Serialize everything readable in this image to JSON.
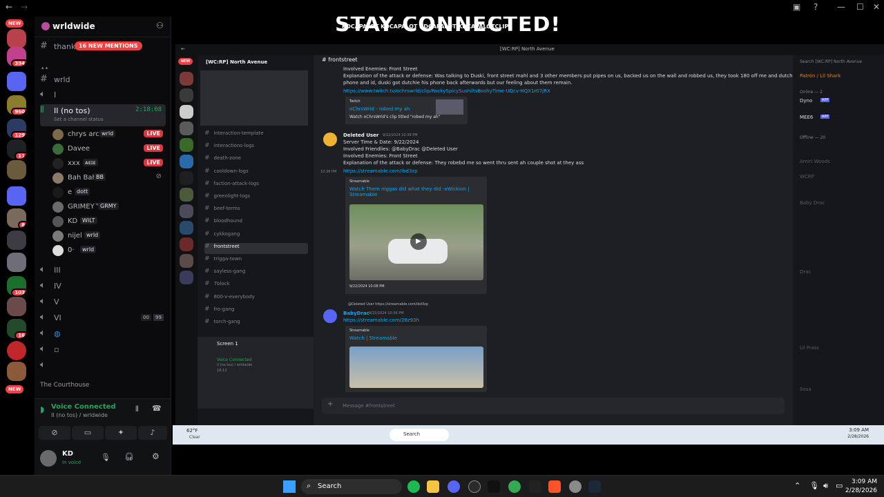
{
  "outer_window": {
    "controls": [
      "—",
      "☐",
      "✕"
    ]
  },
  "rail": {
    "new_top": "NEW",
    "badges": [
      "394",
      "960",
      "129",
      "11",
      "8",
      "103",
      "16"
    ],
    "new_bottom": "NEW"
  },
  "sidebar": {
    "server_name": "wrldwide",
    "mentions_channel": "thanks",
    "mentions_badge": "16 NEW MENTIONS",
    "text_channel": "wrld",
    "voice_channels_top": [
      "I"
    ],
    "active_voice": {
      "name": "II (no tos)",
      "timer": "2:18:08",
      "status": "Set a channel status"
    },
    "users": [
      {
        "name": "chrys arc",
        "tag": "wrld",
        "live": "LIVE"
      },
      {
        "name": "Davee",
        "tag": "",
        "live": "LIVE"
      },
      {
        "name": "xxx",
        "tag": "ᴀᴇɪᴇ",
        "live": "LIVE"
      },
      {
        "name": "Bah Bah",
        "tag": "BB",
        "live": ""
      },
      {
        "name": "e",
        "tag": "dott",
        "live": ""
      },
      {
        "name": "GRIMEY™",
        "tag": "GRMY",
        "live": ""
      },
      {
        "name": "KD",
        "tag": "WILT",
        "live": ""
      },
      {
        "name": "nijel",
        "tag": "wrld",
        "live": ""
      },
      {
        "name": "0·",
        "tag": "wrld",
        "live": ""
      }
    ],
    "voice_channels_bottom": [
      "III",
      "IV",
      "V",
      "VI"
    ],
    "vi_counts": [
      "00",
      "99"
    ],
    "category": "The Courthouse",
    "voice_panel": {
      "status": "Voice Connected",
      "sub": "II (no tos) / wrldwide"
    },
    "user_panel": {
      "name": "KD",
      "status": "In voice"
    }
  },
  "stream": {
    "banner_title": "STAY CONNECTED!",
    "banner_socials": "KDCAPALOT  KDCAPALOT  KDCAPALOT  KDCAPALOTCLIPS",
    "inner": {
      "window_title": "[WC:RP] North Avenue",
      "server_name": "[WC:RP] North Avenue",
      "new_pill": "NEW",
      "channels": [
        "interaction-template",
        "interactions-logs",
        "death-zone",
        "cooldown-logs",
        "faction-attack-logs",
        "greenlight-logs",
        "beef-terms",
        "bloodhound",
        "cykkogang",
        "frontstreet",
        "trigga-town",
        "sayless-gang",
        "7block",
        "800-v-everybody",
        "fro-gang",
        "torch-gang"
      ],
      "active_channel": "frontstreet",
      "screen_label": "Screen 1",
      "voice_connected": "Voice Connected",
      "voice_sub": "II (no tos) / wrldwide",
      "voice_time": "18:13",
      "chat_channel": "frontstreet",
      "messages": {
        "m1_enemies": "Involved Enemies: Front Street",
        "m1_expl": "Explanation of the attack or defense: Was talking to Duski, front street mahl and 3 other members put pipes on us, backed us on the wall and robbed us, they took 180 off me and dutchies",
        "m1_expl2": "phone and id, duski got dutchie his phone back afterwards but our feeling about them remain.",
        "m1_link": "https://www.twitch.tv/ochrswrld/clip/RockySpicySushiltsBoshyTime-UQcv-HQX1r07jRX",
        "m1_embed_site": "Twitch",
        "m1_embed_title": "oChrsWrld - robed my ah",
        "m1_embed_desc": "Watch oChrsWrld's clip titled \"robed my ah\"",
        "m2_author": "Deleted User",
        "m2_time": "9/22/2024 10:36 PM",
        "m2_server_time": "Server Time & Date: 9/22/2024",
        "m2_friendlies": "Involved Friendlies: @BabyDrac @Deleted User",
        "m2_enemies": "Involved Enemies: Front Street",
        "m2_expl": "Explanation of the attack or defense: They robebd me so went thru sent ah couple shot at they ass",
        "m2_link": "https://streamable.com/ibd3zp",
        "m2_side_time": "10:36 PM",
        "m2_embed_site": "Streamable",
        "m2_embed_title": "Watch Them niggas did what they did -xWickion | Streamable",
        "m2_video_time": "9/22/2024 10:08 PM",
        "m3_reply": "@Deleted User https://streamable.com/ibd3zp",
        "m3_author": "BabyDrac",
        "m3_time": "9/22/2024 10:36 PM",
        "m3_link": "https://streamable.com/28z93h",
        "m3_embed_site": "Streamable",
        "m3_embed_title": "Watch | Streamable"
      },
      "composer_placeholder": "Message #frontstreet",
      "members": {
        "search_placeholder": "Search [WC:RP] North Avenue",
        "top_member": "Patrón / Lil Shark",
        "online_header": "Online — 2",
        "online": [
          {
            "name": "Dyno",
            "badge": "APP"
          },
          {
            "name": "MEE6",
            "badge": "APP"
          }
        ],
        "offline_header": "Offline — 20",
        "offline": [
          "Amiri Woods",
          "WCRP",
          "Baby Drac",
          "Drac",
          "Lil Frass",
          "Sosa"
        ]
      },
      "taskbar": {
        "weather": "62°F",
        "weather_sub": "Clear",
        "search": "Search",
        "time": "3:09 AM",
        "date": "2/28/2026"
      }
    }
  },
  "taskbar": {
    "search_label": "Search",
    "time": "3:09 AM",
    "date": "2/28/2026"
  },
  "colors": {
    "accent": "#5865f2",
    "live": "#da373c",
    "mention": "#f23f43",
    "online": "#23a55a"
  }
}
